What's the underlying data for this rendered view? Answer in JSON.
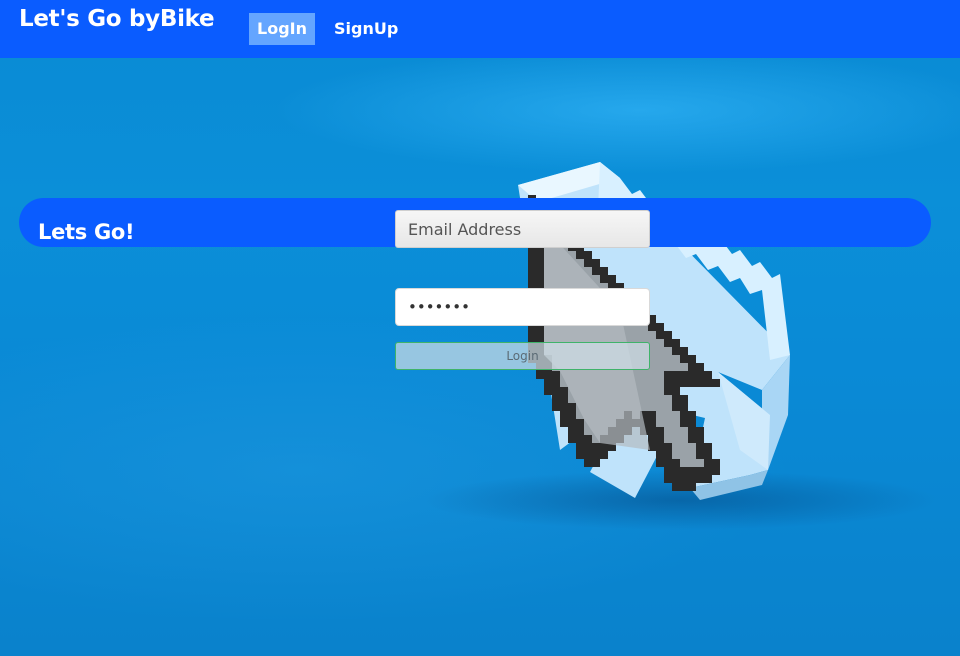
{
  "navbar": {
    "brand": "Let's Go byBike",
    "items": [
      {
        "label": "LogIn",
        "active": true
      },
      {
        "label": "SignUp",
        "active": false
      }
    ]
  },
  "hero": {
    "title": "Lets Go!"
  },
  "form": {
    "email_placeholder": "Email Address",
    "email_value": "",
    "password_value": "1234567",
    "login_label": "Login"
  },
  "background": {
    "image": "cursor-arrow-icon",
    "color": "#0a8ad4"
  },
  "colors": {
    "navbar": "#0a5cff",
    "active_nav": "#64a5ff",
    "hero_bar": "#0a5cff",
    "login_border": "#3fb36a"
  }
}
